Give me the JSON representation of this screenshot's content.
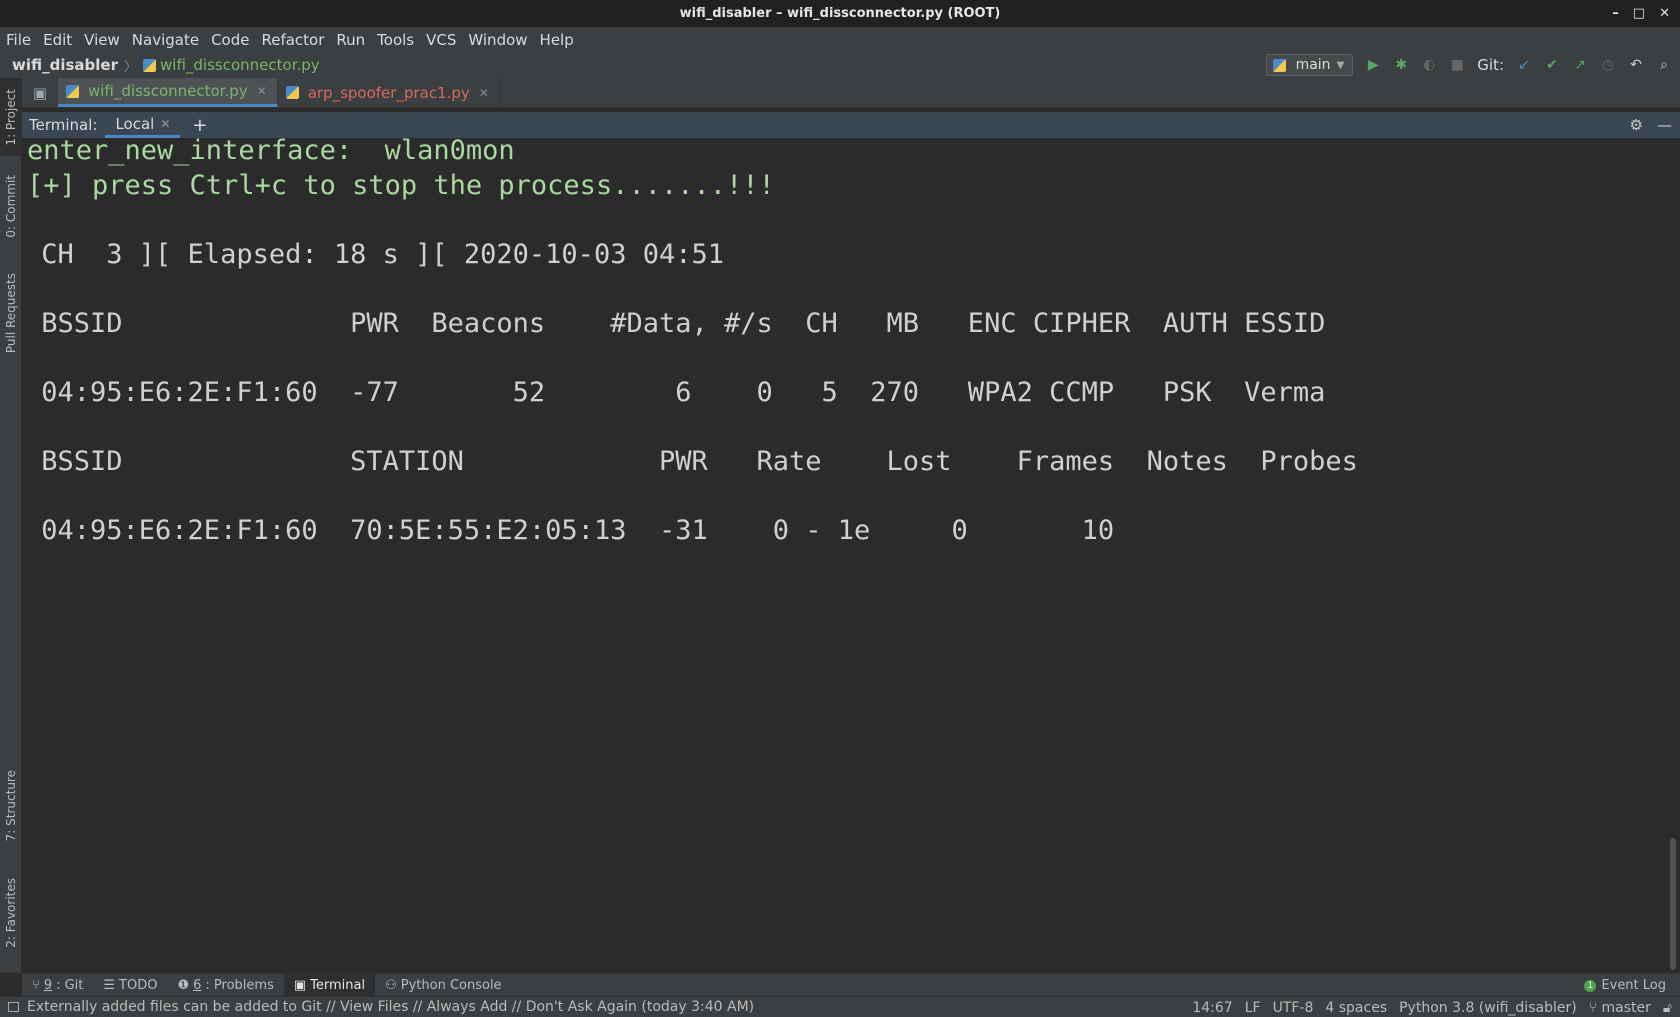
{
  "window": {
    "title": "wifi_disabler – wifi_dissconnector.py (ROOT)",
    "controls": {
      "minimize": "–",
      "maximize": "□",
      "close": "✕"
    }
  },
  "menu": [
    "File",
    "Edit",
    "View",
    "Navigate",
    "Code",
    "Refactor",
    "Run",
    "Tools",
    "VCS",
    "Window",
    "Help"
  ],
  "breadcrumb": {
    "project": "wifi_disabler",
    "file": "wifi_dissconnector.py"
  },
  "toolbar": {
    "run_config": "main",
    "git_label": "Git:"
  },
  "left_tools": {
    "project": "1: Project",
    "commit": "0: Commit",
    "pull_requests": "Pull Requests",
    "structure": "7: Structure",
    "favorites": "2: Favorites"
  },
  "editor_tabs": [
    {
      "label": "wifi_dissconnector.py",
      "active": true,
      "color": "#7ab56a"
    },
    {
      "label": "arp_spoofer_prac1.py",
      "active": false,
      "color": "#d66a5b"
    }
  ],
  "terminal": {
    "header_label": "Terminal:",
    "tab": "Local",
    "lines": {
      "interface": "enter_new_interface:  wlan0mon",
      "stop_hint": "[+] press Ctrl+c to stop the process.......!!!",
      "status": " CH  3 ][ Elapsed: 18 s ][ 2020-10-03 04:51",
      "ap_header": " BSSID              PWR  Beacons    #Data, #/s  CH   MB   ENC CIPHER  AUTH ESSID",
      "ap_row": " 04:95:E6:2E:F1:60  -77       52        6    0   5  270   WPA2 CCMP   PSK  Verma",
      "station_header": " BSSID              STATION            PWR   Rate    Lost    Frames  Notes  Probes",
      "station_row": " 04:95:E6:2E:F1:60  70:5E:55:E2:05:13  -31    0 - 1e     0       10"
    }
  },
  "tool_windows": {
    "git_num": "9",
    "git": ": Git",
    "todo": "TODO",
    "problems_num": "6",
    "problems": ": Problems",
    "terminal": "Terminal",
    "python_console": "Python Console",
    "event_log": "Event Log",
    "event_count": "1"
  },
  "status": {
    "message": "Externally added files can be added to Git // View Files // Always Add // Don't Ask Again (today 3:40 AM)",
    "position": "14:67",
    "line_ending": "LF",
    "encoding": "UTF-8",
    "indent": "4 spaces",
    "interpreter": "Python 3.8 (wifi_disabler)",
    "branch": "master"
  },
  "colors": {
    "terminal_green": "#a9d8a0",
    "terminal_text": "#d0d0d0",
    "accent_blue": "#4a88c7",
    "active_file_green": "#7ab56a",
    "modified_file_red": "#d66a5b"
  }
}
